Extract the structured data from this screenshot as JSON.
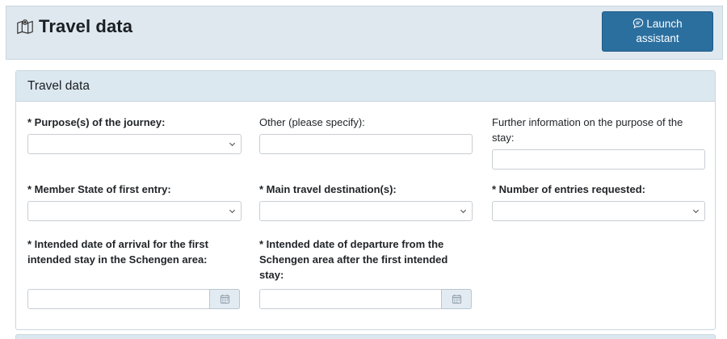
{
  "header": {
    "title": "Travel data",
    "assistant_button_line1": "Launch",
    "assistant_button_line2": "assistant"
  },
  "section": {
    "title": "Travel data",
    "fields": {
      "purpose": {
        "label": "* Purpose(s) of the journey:",
        "value": ""
      },
      "other": {
        "label": "Other (please specify):",
        "value": ""
      },
      "further_info": {
        "label": "Further information on the purpose of the stay:",
        "value": ""
      },
      "member_state": {
        "label": "* Member State of first entry:",
        "value": ""
      },
      "destination": {
        "label": "* Main travel destination(s):",
        "value": ""
      },
      "entries": {
        "label": "* Number of entries requested:",
        "value": ""
      },
      "arrival": {
        "label": "* Intended date of arrival for the first intended stay in the Schengen area:",
        "value": ""
      },
      "departure": {
        "label": "* Intended date of departure from the Schengen area after the first intended stay:",
        "value": ""
      }
    }
  },
  "icons": {
    "title": "map-icon",
    "assistant": "chat-bubble-icon",
    "select": "chevron-down-icon",
    "date": "calendar-icon"
  },
  "colors": {
    "header_bg": "#dfe8ef",
    "button_bg": "#2b6f9f",
    "card_header_bg": "#dce8f0"
  }
}
